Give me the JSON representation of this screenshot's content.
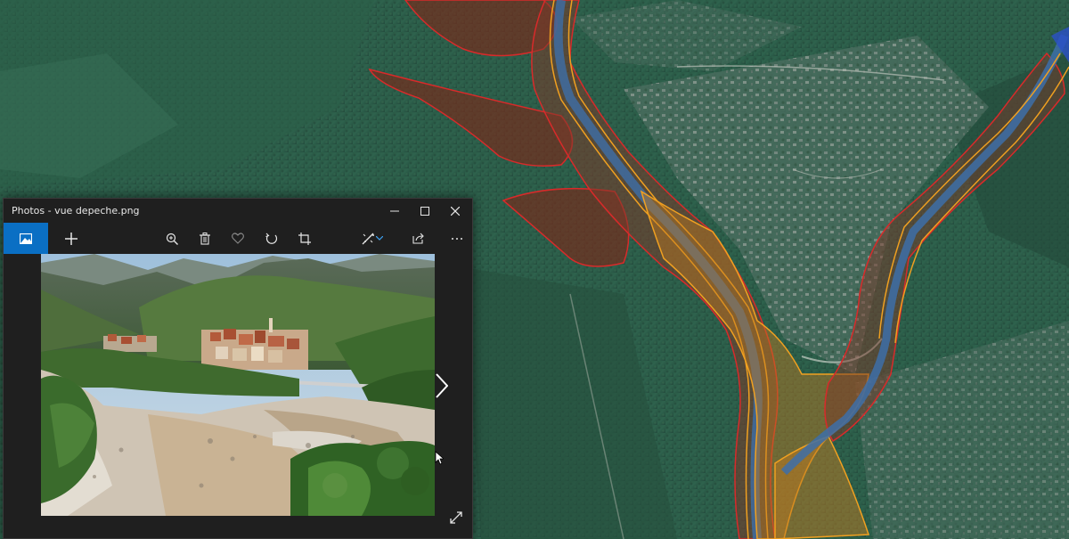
{
  "window": {
    "title": "Photos - vue depeche.png"
  },
  "titlebar_controls": [
    "minimize-icon",
    "maximize-icon",
    "close-icon"
  ],
  "toolbar": {
    "left": [
      "photo-view-icon",
      "add-icon"
    ],
    "center": [
      "zoom-icon",
      "delete-icon",
      "favorite-icon",
      "rotate-icon",
      "crop-icon"
    ],
    "right": [
      "edit-icon",
      "dropdown-icon",
      "share-icon",
      "more-icon"
    ]
  },
  "colors": {
    "accent": "#0a6fc4",
    "window_bg": "#1f1f1f",
    "flood_zone_fill": "#7a2a1a",
    "flood_zone_stroke": "#d82a2a",
    "river_line": "#f0a020",
    "river_channel": "#3d6ea8"
  }
}
